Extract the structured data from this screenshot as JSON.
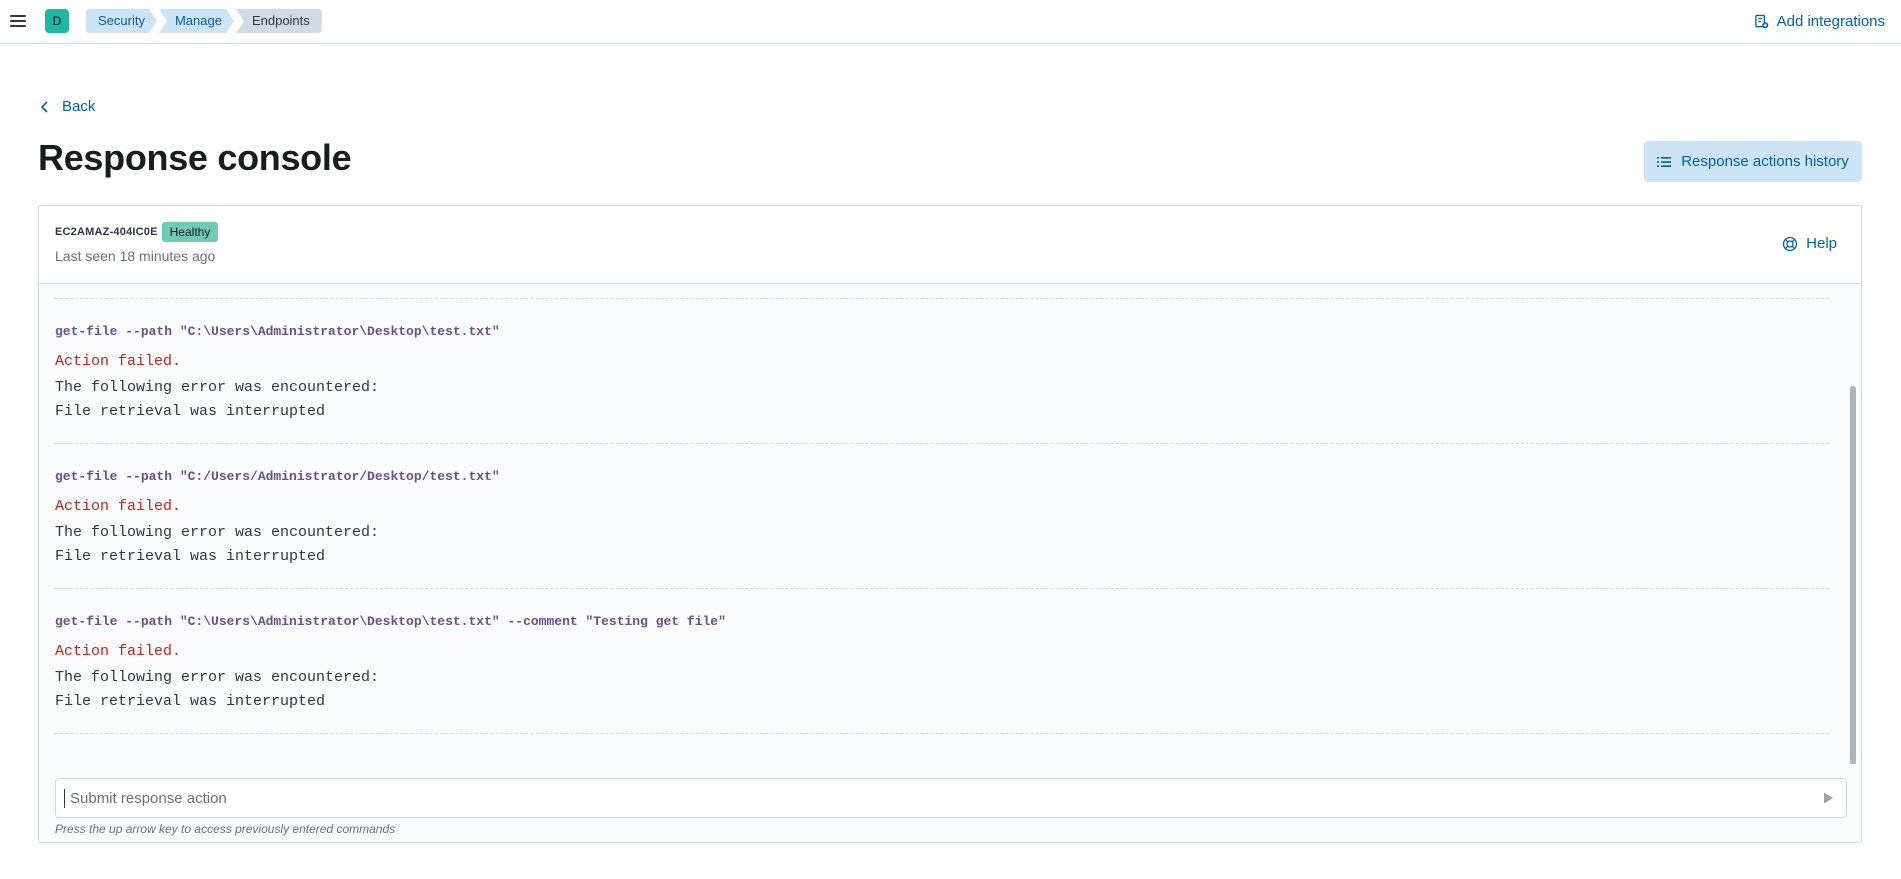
{
  "header": {
    "space_initial": "D",
    "breadcrumbs": [
      "Security",
      "Manage",
      "Endpoints"
    ],
    "add_integrations": "Add integrations"
  },
  "page": {
    "back": "Back",
    "title": "Response console",
    "history_button": "Response actions history"
  },
  "console": {
    "host_name": "EC2AMAZ-404IC0E",
    "status": "Healthy",
    "last_seen": "Last seen 18 minutes ago",
    "help": "Help",
    "entries": [
      {
        "command": "get-file --path \"C:\\Users\\Administrator\\Desktop\\test.txt\"",
        "result": "Action failed.",
        "error_title": "The following error was encountered:",
        "error_detail": "File retrieval was interrupted"
      },
      {
        "command": "get-file --path \"C:/Users/Administrator/Desktop/test.txt\"",
        "result": "Action failed.",
        "error_title": "The following error was encountered:",
        "error_detail": "File retrieval was interrupted"
      },
      {
        "command": "get-file --path \"C:\\Users\\Administrator\\Desktop\\test.txt\" --comment \"Testing get file\"",
        "result": "Action failed.",
        "error_title": "The following error was encountered:",
        "error_detail": "File retrieval was interrupted"
      }
    ],
    "input_placeholder": "Submit response action",
    "hint": "Press the up arrow key to access previously entered commands"
  },
  "colors": {
    "link": "#0061a6",
    "command": "#6b4f8f",
    "error": "#bd271e",
    "healthy": "#6dccb1",
    "button_bg": "#cce4f5"
  }
}
